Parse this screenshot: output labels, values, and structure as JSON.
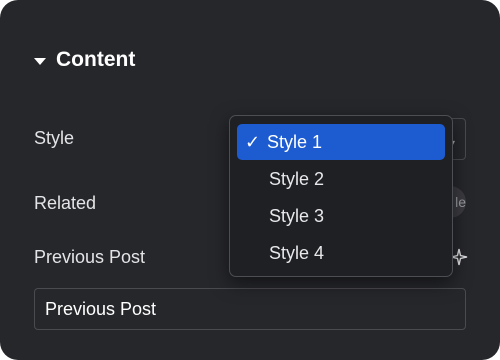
{
  "section": {
    "title": "Content"
  },
  "fields": {
    "style_label": "Style",
    "related_label": "Related",
    "related_toggle_text": "le",
    "previous_post_label": "Previous Post",
    "previous_post_value": "Previous Post"
  },
  "dropdown": {
    "options": [
      {
        "label": "Style 1",
        "selected": true
      },
      {
        "label": "Style 2",
        "selected": false
      },
      {
        "label": "Style 3",
        "selected": false
      },
      {
        "label": "Style 4",
        "selected": false
      }
    ],
    "check_glyph": "✓"
  },
  "colors": {
    "panel_bg": "#26272b",
    "selected_bg": "#1d5bd1"
  },
  "icons": [
    "caret-down-icon",
    "check-icon",
    "ai-sparkle-icon",
    "select-arrow-icon"
  ]
}
